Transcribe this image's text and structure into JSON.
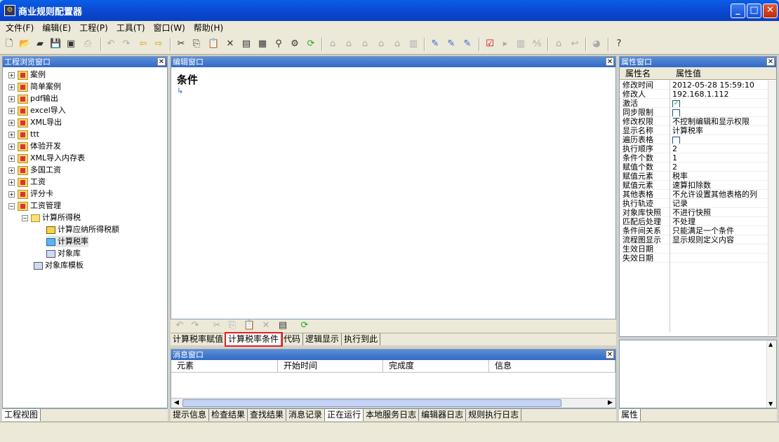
{
  "window": {
    "title": "商业规则配置器",
    "icon": "app-icon"
  },
  "menu": [
    "文件(F)",
    "编辑(E)",
    "工程(P)",
    "工具(T)",
    "窗口(W)",
    "帮助(H)"
  ],
  "project_panel": {
    "title": "工程浏览窗口",
    "tree": [
      {
        "label": "案例"
      },
      {
        "label": "简单案例"
      },
      {
        "label": "pdf输出"
      },
      {
        "label": "excel导入"
      },
      {
        "label": "XML导出"
      },
      {
        "label": "ttt"
      },
      {
        "label": "体验开发"
      },
      {
        "label": "XML导入内存表"
      },
      {
        "label": "多国工资"
      },
      {
        "label": "工资"
      },
      {
        "label": "评分卡"
      },
      {
        "label": "工资管理"
      }
    ],
    "sub": {
      "folder": "计算所得税",
      "items": [
        "计算应纳所得税额",
        "计算税率",
        "对象库"
      ],
      "template": "对象库模板"
    },
    "bottom_tab": "工程视图"
  },
  "editor_panel": {
    "title": "编辑窗口",
    "heading": "条件",
    "tabs": [
      "计算税率赋值",
      "计算税率条件",
      "代码",
      "逻辑显示",
      "执行到此"
    ],
    "active_tab": 1
  },
  "message_panel": {
    "title": "消息窗口",
    "columns": [
      "元素",
      "开始时间",
      "完成度",
      "信息"
    ],
    "tabs": [
      "提示信息",
      "检查结果",
      "查找结果",
      "消息记录",
      "正在运行",
      "本地服务日志",
      "编辑器日志",
      "规则执行日志"
    ]
  },
  "property_panel": {
    "title": "属性窗口",
    "header_name": "属性名",
    "header_value": "属性值",
    "rows": [
      {
        "name": "修改时间",
        "value": "2012-05-28 15:59:10"
      },
      {
        "name": "修改人",
        "value": "192.168.1.112"
      },
      {
        "name": "激活",
        "value": "",
        "checkbox": true,
        "checked": true
      },
      {
        "name": "同步限制",
        "value": "",
        "checkbox": true,
        "checked": false
      },
      {
        "name": "修改权限",
        "value": "不控制编辑和显示权限"
      },
      {
        "name": "显示名称",
        "value": "计算税率"
      },
      {
        "name": "遍历表格",
        "value": "",
        "checkbox": true,
        "checked": false
      },
      {
        "name": "执行顺序",
        "value": "2"
      },
      {
        "name": "条件个数",
        "value": "1"
      },
      {
        "name": "赋值个数",
        "value": "2"
      },
      {
        "name": "赋值元素",
        "value": "税率"
      },
      {
        "name": "赋值元素",
        "value": "速算扣除数"
      },
      {
        "name": "其他表格",
        "value": "不允许设置其他表格的列"
      },
      {
        "name": "执行轨迹",
        "value": "记录"
      },
      {
        "name": "对象库快照",
        "value": "不进行快照"
      },
      {
        "name": "匹配后处理",
        "value": "不处理"
      },
      {
        "name": "条件间关系",
        "value": "只能满足一个条件"
      },
      {
        "name": "流程图显示",
        "value": "显示规则定义内容"
      },
      {
        "name": "生效日期",
        "value": ""
      },
      {
        "name": "失效日期",
        "value": ""
      }
    ],
    "bottom_tab": "属性"
  }
}
